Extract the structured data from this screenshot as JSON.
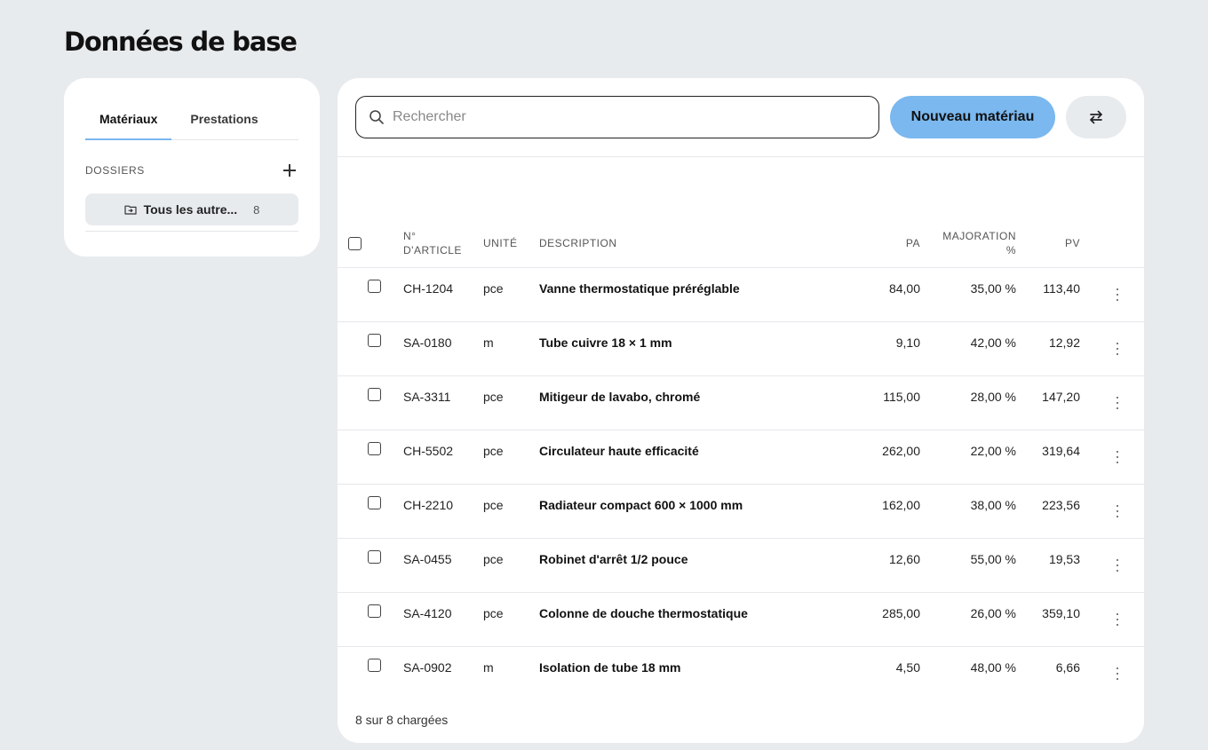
{
  "page": {
    "title": "Données de base"
  },
  "sidebar": {
    "tabs": [
      {
        "label": "Matériaux",
        "active": true
      },
      {
        "label": "Prestations",
        "active": false
      }
    ],
    "folders_label": "DOSSIERS",
    "folder": {
      "name": "Tous les autre...",
      "count": "8"
    }
  },
  "toolbar": {
    "search_placeholder": "Rechercher",
    "search_value": "",
    "new_button_label": "Nouveau matériau"
  },
  "table": {
    "columns": {
      "article_line1": "N°",
      "article_line2": "D'ARTICLE",
      "unit": "UNITÉ",
      "description": "DESCRIPTION",
      "pa": "PA",
      "markup_line1": "MAJORATION",
      "markup_line2": "%",
      "pv": "PV"
    },
    "rows": [
      {
        "article": "CH-1204",
        "unit": "pce",
        "description": "Vanne thermostatique préréglable",
        "pa": "84,00",
        "markup": "35,00 %",
        "pv": "113,40"
      },
      {
        "article": "SA-0180",
        "unit": "m",
        "description": "Tube cuivre 18 × 1 mm",
        "pa": "9,10",
        "markup": "42,00 %",
        "pv": "12,92"
      },
      {
        "article": "SA-3311",
        "unit": "pce",
        "description": "Mitigeur de lavabo, chromé",
        "pa": "115,00",
        "markup": "28,00 %",
        "pv": "147,20"
      },
      {
        "article": "CH-5502",
        "unit": "pce",
        "description": "Circulateur haute efficacité",
        "pa": "262,00",
        "markup": "22,00 %",
        "pv": "319,64"
      },
      {
        "article": "CH-2210",
        "unit": "pce",
        "description": "Radiateur compact 600 × 1000 mm",
        "pa": "162,00",
        "markup": "38,00 %",
        "pv": "223,56"
      },
      {
        "article": "SA-0455",
        "unit": "pce",
        "description": "Robinet d'arrêt 1/2 pouce",
        "pa": "12,60",
        "markup": "55,00 %",
        "pv": "19,53"
      },
      {
        "article": "SA-4120",
        "unit": "pce",
        "description": "Colonne de douche thermostatique",
        "pa": "285,00",
        "markup": "26,00 %",
        "pv": "359,10"
      },
      {
        "article": "SA-0902",
        "unit": "m",
        "description": "Isolation de tube 18 mm",
        "pa": "4,50",
        "markup": "48,00 %",
        "pv": "6,66"
      }
    ],
    "footer": "8 sur 8 chargées"
  },
  "colors": {
    "accent": "#7ab8ef",
    "background": "#e8ebee",
    "panel": "#ffffff"
  },
  "icons": {
    "search": "search-icon",
    "add": "plus-icon",
    "folder": "folder-icon",
    "swap": "swap-arrows-icon",
    "row_menu": "kebab-menu-icon"
  }
}
